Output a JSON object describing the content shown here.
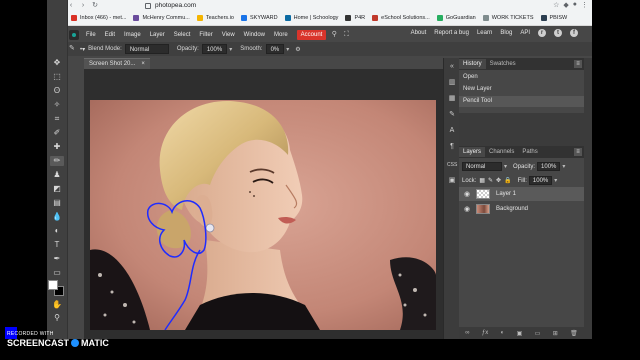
{
  "browser": {
    "url": "photopea.com",
    "bookmarks": [
      {
        "label": "Inbox (466) - met...",
        "color": "#d93025"
      },
      {
        "label": "McHenry Commu...",
        "color": "#6a4c9c"
      },
      {
        "label": "Teachers.io",
        "color": "#f4b400"
      },
      {
        "label": "SKYWARD",
        "color": "#1a73e8"
      },
      {
        "label": "Home | Schoology",
        "color": "#0b6aa2"
      },
      {
        "label": "P4R",
        "color": "#333333"
      },
      {
        "label": "eSchool Solutions...",
        "color": "#c0392b"
      },
      {
        "label": "GoGuardian",
        "color": "#27ae60"
      },
      {
        "label": "WORK TICKETS",
        "color": "#7f8c8d"
      },
      {
        "label": "PBISW",
        "color": "#2c3e50"
      }
    ]
  },
  "menubar": {
    "menus": [
      "File",
      "Edit",
      "Image",
      "Layer",
      "Select",
      "Filter",
      "View",
      "Window",
      "More"
    ],
    "account": "Account",
    "right_links": [
      "About",
      "Report a bug",
      "Learn",
      "Blog",
      "API"
    ],
    "social_icons": [
      "reddit-icon",
      "twitter-icon",
      "facebook-icon"
    ]
  },
  "options": {
    "blend_label": "Blend Mode:",
    "blend_value": "Normal",
    "opacity_label": "Opacity:",
    "opacity_value": "100%",
    "smooth_label": "Smooth:",
    "smooth_value": "0%"
  },
  "document": {
    "tab_title": "Screen Shot 20...",
    "close_glyph": "×"
  },
  "history": {
    "tabs": [
      "History",
      "Swatches"
    ],
    "items": [
      "Open",
      "New Layer",
      "Pencil Tool"
    ],
    "selected_index": 2
  },
  "layers": {
    "tabs": [
      "Layers",
      "Channels",
      "Paths"
    ],
    "blend_value": "Normal",
    "opacity_label": "Opacity:",
    "opacity_value": "100%",
    "lock_label": "Lock:",
    "fill_label": "Fill:",
    "fill_value": "100%",
    "items": [
      {
        "name": "Layer 1",
        "selected": true
      },
      {
        "name": "Background",
        "selected": false
      }
    ]
  },
  "colors": {
    "foreground": "#ffffff",
    "background": "#000000",
    "accent": "#d9342b",
    "stroke": "#1f2cff"
  },
  "watermark": {
    "line1": "RECORDED WITH",
    "line2a": "SCREENCAST",
    "line2b": "MATIC"
  }
}
